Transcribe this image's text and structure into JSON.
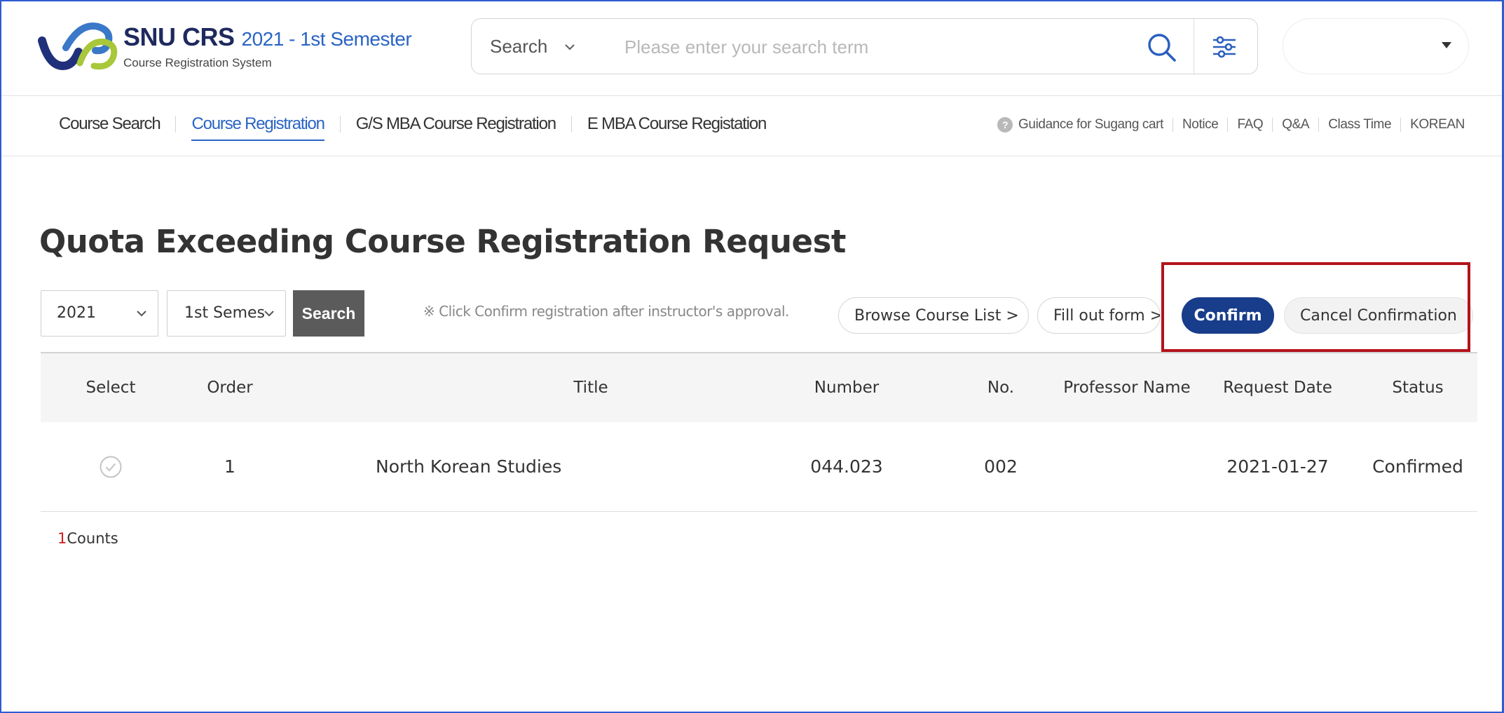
{
  "header": {
    "brand_main": "SNU CRS",
    "brand_semester": "2021 - 1st Semester",
    "brand_sub": "Course Registration System",
    "search": {
      "category": "Search",
      "placeholder": "Please enter your search term",
      "value": ""
    },
    "user_select_value": ""
  },
  "nav": {
    "items": [
      {
        "label": "Course Search",
        "active": false
      },
      {
        "label": "Course Registration",
        "active": true
      },
      {
        "label": "G/S MBA Course Registration",
        "active": false
      },
      {
        "label": "E MBA Course Registation",
        "active": false
      }
    ],
    "utilities": [
      {
        "label": "Guidance for Sugang cart"
      },
      {
        "label": "Notice"
      },
      {
        "label": "FAQ"
      },
      {
        "label": "Q&A"
      },
      {
        "label": "Class Time"
      },
      {
        "label": "KOREAN"
      }
    ]
  },
  "page": {
    "title": "Quota Exceeding Course Registration Request"
  },
  "toolbar": {
    "year_value": "2021",
    "semester_value": "1st Semes",
    "search_label": "Search",
    "notice": "※ Click Confirm registration after instructor's approval.",
    "browse_label": "Browse Course List >",
    "fill_label": "Fill out form >",
    "confirm_label": "Confirm",
    "cancel_label": "Cancel Confirmation"
  },
  "table": {
    "headers": {
      "select": "Select",
      "order": "Order",
      "title": "Title",
      "number": "Number",
      "no": "No.",
      "professor": "Professor Name",
      "date": "Request Date",
      "status": "Status"
    },
    "rows": [
      {
        "order": "1",
        "title": "North Korean Studies",
        "number": "044.023",
        "no": "002",
        "professor": "",
        "date": "2021-01-27",
        "status": "Confirmed"
      }
    ]
  },
  "summary": {
    "count": "1",
    "count_label": "Counts"
  },
  "colors": {
    "accent_blue": "#2a64c4",
    "confirm_navy": "#183d8b",
    "highlight_red": "#b3121a",
    "count_red": "#d11d1d"
  },
  "icons": {
    "logo": "snu-crs-logo",
    "search": "search-icon",
    "filter": "filter-sliders-icon",
    "help": "help-icon",
    "row_check": "check-circle-icon"
  }
}
